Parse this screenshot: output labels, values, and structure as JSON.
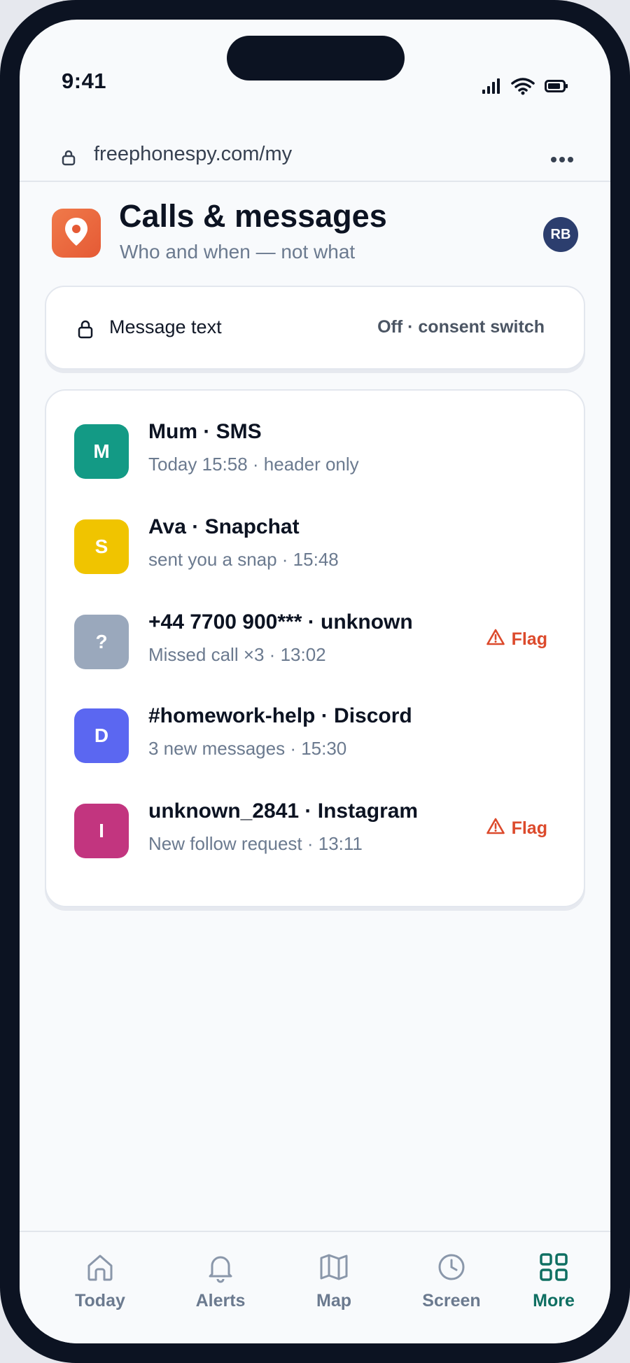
{
  "status_bar": {
    "time": "9:41"
  },
  "browser": {
    "url": "freephonespy.com/my"
  },
  "header": {
    "title": "Calls & messages",
    "subtitle": "Who and when — not what",
    "avatar_initials": "RB"
  },
  "consent": {
    "label": "Message text",
    "state": "Off · consent switch"
  },
  "items": [
    {
      "initial": "M",
      "color": "#139a85",
      "title": "Mum · SMS",
      "subtitle": "Today 15:58 · header only",
      "flag": ""
    },
    {
      "initial": "S",
      "color": "#f0c400",
      "title": "Ava · Snapchat",
      "subtitle": "sent you a snap · 15:48",
      "flag": ""
    },
    {
      "initial": "?",
      "color": "#9aa8bc",
      "title": "+44 7700 900*** · unknown",
      "subtitle": "Missed call ×3 · 13:02",
      "flag": "Flag"
    },
    {
      "initial": "D",
      "color": "#5b67f1",
      "title": "#homework-help · Discord",
      "subtitle": "3 new messages · 15:30",
      "flag": ""
    },
    {
      "initial": "I",
      "color": "#c2357f",
      "title": "unknown_2841 · Instagram",
      "subtitle": "New follow request · 13:11",
      "flag": "Flag"
    }
  ],
  "tabs": [
    {
      "label": "Today",
      "icon": "home-icon",
      "active": false
    },
    {
      "label": "Alerts",
      "icon": "bell-icon",
      "active": false
    },
    {
      "label": "Map",
      "icon": "map-icon",
      "active": false
    },
    {
      "label": "Screen",
      "icon": "clock-icon",
      "active": false
    },
    {
      "label": "More",
      "icon": "grid-icon",
      "active": true
    }
  ],
  "colors": {
    "accent": "#0f6f62",
    "flag": "#dc4a2c",
    "logo": "#e55a35",
    "avatar": "#2c3e6e"
  }
}
